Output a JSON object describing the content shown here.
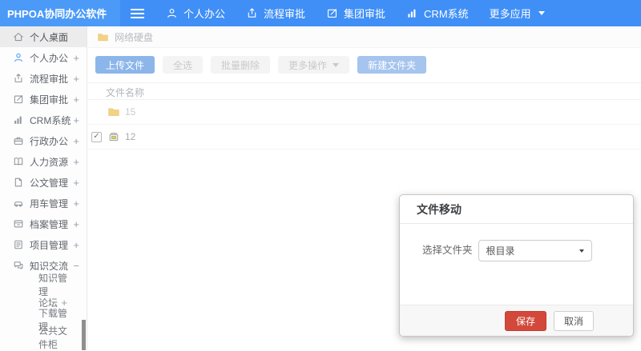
{
  "app": {
    "title": "PHPOA协同办公软件"
  },
  "topnav": {
    "items": [
      {
        "icon": "user-icon",
        "label": "个人办公"
      },
      {
        "icon": "process-icon",
        "label": "流程审批"
      },
      {
        "icon": "edit-icon",
        "label": "集团审批"
      },
      {
        "icon": "chart-icon",
        "label": "CRM系统"
      },
      {
        "icon": "",
        "label": "更多应用",
        "caret": true
      }
    ]
  },
  "sidebar": {
    "items": [
      {
        "icon": "home-icon",
        "label": "个人桌面",
        "active": true,
        "expand": ""
      },
      {
        "icon": "user-icon",
        "label": "个人办公",
        "expand": "+",
        "icon_color": "blue"
      },
      {
        "icon": "process-icon",
        "label": "流程审批",
        "expand": "+"
      },
      {
        "icon": "edit-icon",
        "label": "集团审批",
        "expand": "+"
      },
      {
        "icon": "chart-icon",
        "label": "CRM系统",
        "expand": "+"
      },
      {
        "icon": "briefcase-icon",
        "label": "行政办公",
        "expand": "+"
      },
      {
        "icon": "book-icon",
        "label": "人力资源",
        "expand": "+"
      },
      {
        "icon": "doc-icon",
        "label": "公文管理",
        "expand": "+"
      },
      {
        "icon": "car-icon",
        "label": "用车管理",
        "expand": "+"
      },
      {
        "icon": "archive-icon",
        "label": "档案管理",
        "expand": "+"
      },
      {
        "icon": "project-icon",
        "label": "项目管理",
        "expand": "+"
      },
      {
        "icon": "chat-icon",
        "label": "知识交流",
        "expand": "−",
        "children": [
          {
            "label": "知识管理",
            "expand": ""
          },
          {
            "label": "论坛",
            "expand": "+"
          },
          {
            "label": "下载管理",
            "expand": ""
          },
          {
            "label": "公共文件柜",
            "expand": ""
          }
        ]
      }
    ]
  },
  "breadcrumb": {
    "icon": "folder-icon",
    "label": "网络硬盘"
  },
  "toolbar": {
    "buttons": [
      {
        "label": "上传文件",
        "variant": "primary"
      },
      {
        "label": "全选",
        "variant": "default"
      },
      {
        "label": "批量删除",
        "variant": "default"
      },
      {
        "label": "更多操作",
        "variant": "default",
        "caret": true
      },
      {
        "label": "新建文件夹",
        "variant": "primary-light"
      }
    ]
  },
  "file_table": {
    "header": "文件名称",
    "rows": [
      {
        "icon": "folder-icon",
        "name": "15",
        "checked": null,
        "dim": true
      },
      {
        "icon": "drive-icon",
        "name": "12",
        "checked": true,
        "dim": false
      }
    ]
  },
  "modal": {
    "title": "文件移动",
    "field_label": "选择文件夹",
    "select_value": "根目录",
    "save_label": "保存",
    "cancel_label": "取消"
  },
  "colors": {
    "topbar_blue": "#3f8ff7",
    "logo_blue": "#4b9af8",
    "primary_button_blue": "#8cb6ea",
    "save_red": "#d2483a",
    "folder_yellow": "#f2d385"
  }
}
